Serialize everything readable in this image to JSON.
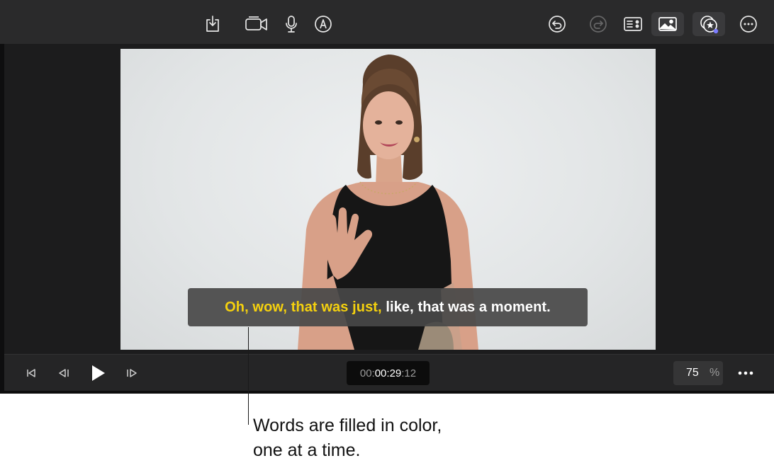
{
  "toolbar": {
    "left_icons": [
      "import-icon",
      "camera-icon",
      "microphone-icon",
      "markup-icon"
    ],
    "right_icons": [
      "undo-icon",
      "redo-icon",
      "inspector-icon",
      "photos-icon",
      "effects-icon",
      "more-icon"
    ]
  },
  "caption": {
    "highlighted": "Oh, wow, that was just,",
    "rest": " like, that was a moment.",
    "highlight_color": "#f5d10e",
    "rest_color": "#ffffff"
  },
  "transport": {
    "timecode_prefix": "00:",
    "timecode_main": "00:29",
    "timecode_suffix": ":12",
    "zoom_value": "75",
    "zoom_unit": "%"
  },
  "annotation": {
    "line1": "Words are filled in color,",
    "line2": "one at a time."
  }
}
